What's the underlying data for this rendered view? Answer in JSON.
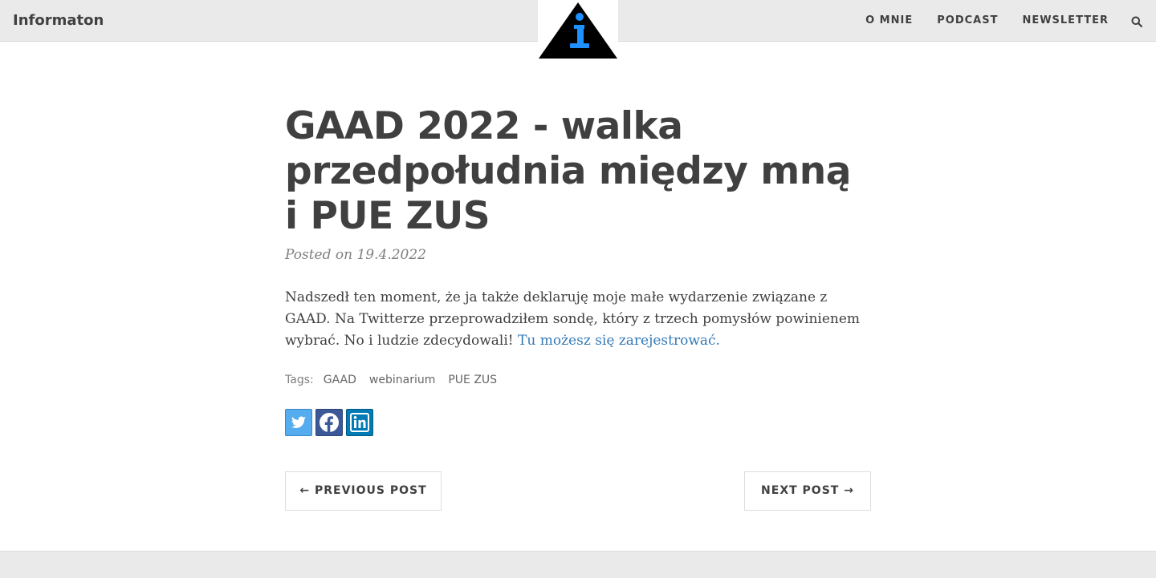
{
  "navbar": {
    "brand": "Informaton",
    "links": [
      "O MNIE",
      "PODCAST",
      "NEWSLETTER"
    ],
    "search_icon": "search-icon",
    "logo_icon": "info-triangle-icon"
  },
  "post": {
    "title": "GAAD 2022 - walka przedpołudnia między mną i PUE ZUS",
    "meta": "Posted on 19.4.2022",
    "body_text": "Nadszedł ten moment, że ja także deklaruję moje małe wydarzenie związane z GAAD. Na Twitterze przeprowadziłem sondę, który z trzech pomysłów powinienem wybrać. No i ludzie zdecydowali! ",
    "body_link": "Tu możesz się zarejestrować.",
    "tags_label": "Tags:",
    "tags": [
      "GAAD",
      "webinarium",
      "PUE ZUS"
    ],
    "share_icons": [
      "twitter-icon",
      "facebook-icon",
      "linkedin-icon"
    ]
  },
  "pager": {
    "previous": "← PREVIOUS POST",
    "next": "NEXT POST →"
  },
  "colors": {
    "navbar_bg": "#eaeaea",
    "text": "#404040",
    "link": "#337ab7",
    "logo_accent": "#1e90ff"
  }
}
